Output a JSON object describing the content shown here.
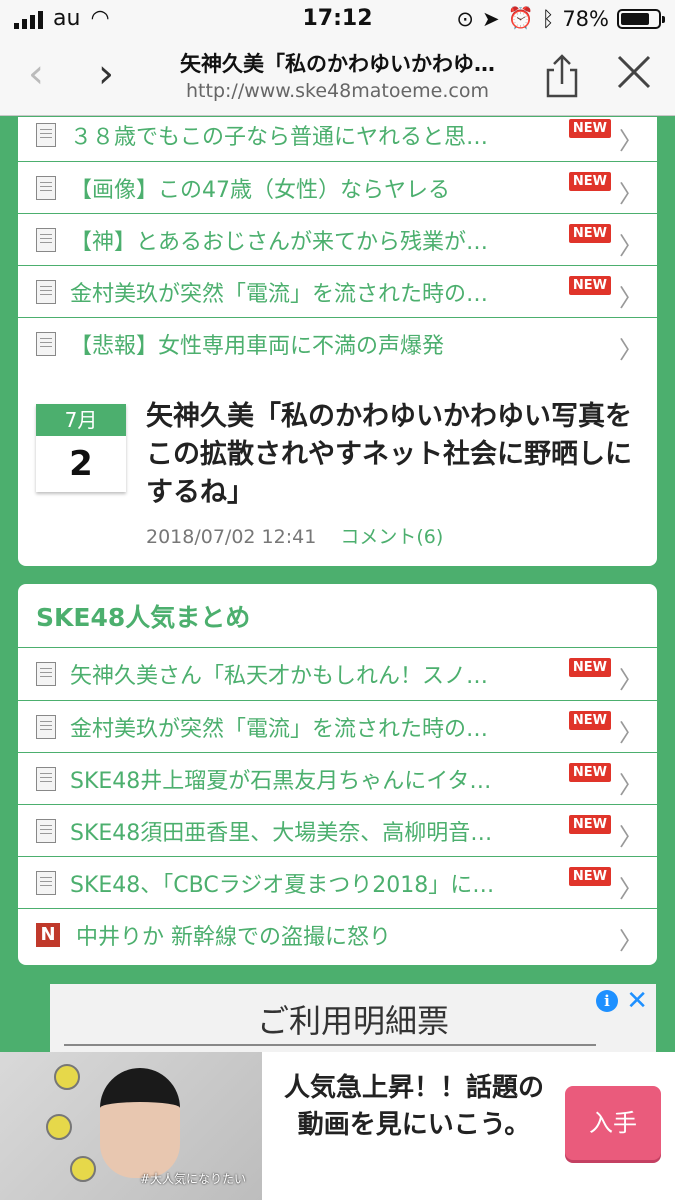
{
  "status": {
    "carrier": "au",
    "time": "17:12",
    "battery": "78%",
    "battery_level": 0.78
  },
  "browser": {
    "title": "矢神久美「私のかわゆいかわゆ…",
    "url": "http://www.ske48matoeme.com",
    "back": "‹",
    "forward": "›",
    "share": "share",
    "close": "×"
  },
  "related_list": [
    {
      "title": "３８歳でもこの子なら普通にヤれると思…",
      "new": "NEW"
    },
    {
      "title": "【画像】この47歳（女性）ならヤレる",
      "new": "NEW"
    },
    {
      "title": "【神】とあるおじさんが来てから残業が…",
      "new": "NEW"
    },
    {
      "title": "金村美玖が突然「電流」を流された時の…",
      "new": "NEW"
    },
    {
      "title": "【悲報】女性専用車両に不満の声爆発",
      "new": ""
    }
  ],
  "article": {
    "month": "7月",
    "day": "2",
    "title": "矢神久美「私のかわゆいかわゆい写真をこの拡散されやすネット社会に野晒しにするね」",
    "datetime": "2018/07/02 12:41",
    "comments": "コメント(6)"
  },
  "popular": {
    "heading": "SKE48人気まとめ",
    "items": [
      {
        "title": "矢神久美さん「私天才かもしれん！スノ…",
        "new": "NEW"
      },
      {
        "title": "金村美玖が突然「電流」を流された時の…",
        "new": "NEW"
      },
      {
        "title": "SKE48井上瑠夏が石黒友月ちゃんにイタ…",
        "new": "NEW"
      },
      {
        "title": "SKE48須田亜香里、大場美奈、高柳明音…",
        "new": "NEW"
      },
      {
        "title": "SKE48、「CBCラジオ夏まつり2018」に…",
        "new": "NEW"
      }
    ],
    "news_item": {
      "icon": "N",
      "title": "中井りか 新幹線での盗撮に怒り"
    }
  },
  "ad_preview": {
    "text": "ご利用明細票"
  },
  "banner": {
    "caption": "#大人気になりたい",
    "text": "人気急上昇！！話題の動画を見にいこう。",
    "button": "入手"
  },
  "colors": {
    "accent": "#4caf6e",
    "new_badge": "#e0342a",
    "button": "#ea5b7c"
  }
}
